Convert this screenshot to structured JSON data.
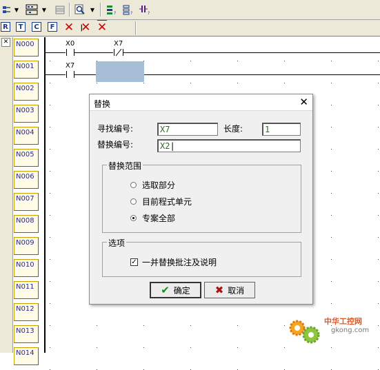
{
  "toolbar": {
    "row1_icons": [
      "network-icon",
      "grid-icon",
      "table-icon",
      "zoom-icon",
      "ladder-icon",
      "ladder-sample-icon",
      "contact-icon"
    ],
    "row2_buttons": [
      "R",
      "T",
      "C",
      "F"
    ],
    "row2_delete_icons": [
      "delete-icon",
      "delete-step-icon",
      "delete-all-icon"
    ]
  },
  "ladder": {
    "steps": [
      "N000",
      "N001",
      "N002",
      "N003",
      "N004",
      "N005",
      "N006",
      "N007",
      "N008",
      "N009",
      "N010",
      "N011",
      "N012",
      "N013",
      "N014"
    ],
    "rung0": {
      "contact1": "X0",
      "contact2": "X7"
    },
    "rung1": {
      "contact1": "X7"
    }
  },
  "dialog": {
    "title": "替换",
    "find_label": "寻找编号:",
    "find_value": "X7",
    "length_label": "长度:",
    "length_value": "1",
    "replace_label": "替换编号:",
    "replace_value": "X2",
    "scope_group": "替换范围",
    "scope_options": [
      {
        "label": "选取部分",
        "checked": false
      },
      {
        "label": "目前程式单元",
        "checked": false
      },
      {
        "label": "专案全部",
        "checked": true
      }
    ],
    "options_group": "选项",
    "also_replace_comments": "一并替换批注及说明",
    "also_replace_checked": true,
    "ok": "确定",
    "cancel": "取消"
  },
  "watermark": {
    "text": "中华工控网",
    "url": "gkong.com"
  },
  "colors": {
    "selection": "#a6bfd6",
    "step_border": "#c8a000",
    "ok_icon": "#1a8a1a",
    "cancel_icon": "#aa1111"
  }
}
